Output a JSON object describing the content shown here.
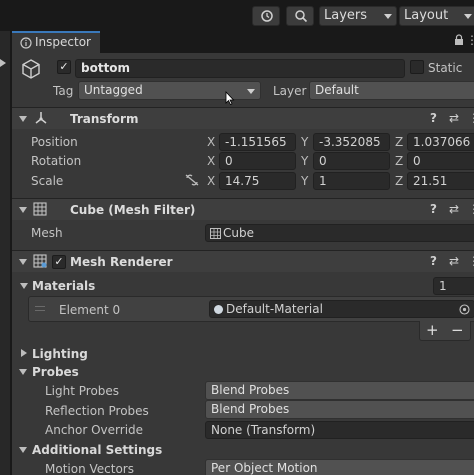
{
  "toolbar": {
    "history_icon": "history-icon",
    "search_icon": "search-icon",
    "layers_label": "Layers",
    "layout_label": "Layout"
  },
  "tab": {
    "title": "Inspector"
  },
  "object": {
    "active_check": "✓",
    "name": "bottom",
    "static_label": "Static",
    "tag_label": "Tag",
    "tag_value": "Untagged",
    "layer_label": "Layer",
    "layer_value": "Default"
  },
  "transform": {
    "title": "Transform",
    "rows": [
      {
        "label": "Position",
        "x": "-1.151565",
        "y": "-3.352085",
        "z": "1.037066"
      },
      {
        "label": "Rotation",
        "x": "0",
        "y": "0",
        "z": "0"
      },
      {
        "label": "Scale",
        "x": "14.75",
        "y": "1",
        "z": "21.51"
      }
    ],
    "axis": {
      "x": "X",
      "y": "Y",
      "z": "Z"
    }
  },
  "mesh_filter": {
    "title": "Cube (Mesh Filter)",
    "mesh_label": "Mesh",
    "mesh_value": "Cube"
  },
  "mesh_renderer": {
    "title": "Mesh Renderer",
    "enabled_check": "✓",
    "materials_label": "Materials",
    "materials_count": "1",
    "element_label": "Element 0",
    "element_value": "Default-Material",
    "add_label": "+",
    "remove_label": "−",
    "lighting_label": "Lighting",
    "probes_label": "Probes",
    "light_probes_label": "Light Probes",
    "light_probes_value": "Blend Probes",
    "reflection_probes_label": "Reflection Probes",
    "reflection_probes_value": "Blend Probes",
    "anchor_override_label": "Anchor Override",
    "anchor_override_value": "None (Transform)",
    "additional_settings_label": "Additional Settings",
    "motion_vectors_label": "Motion Vectors",
    "motion_vectors_value": "Per Object Motion"
  },
  "header_icons": {
    "help": "?",
    "presets": "⇄",
    "menu": "⋮"
  }
}
